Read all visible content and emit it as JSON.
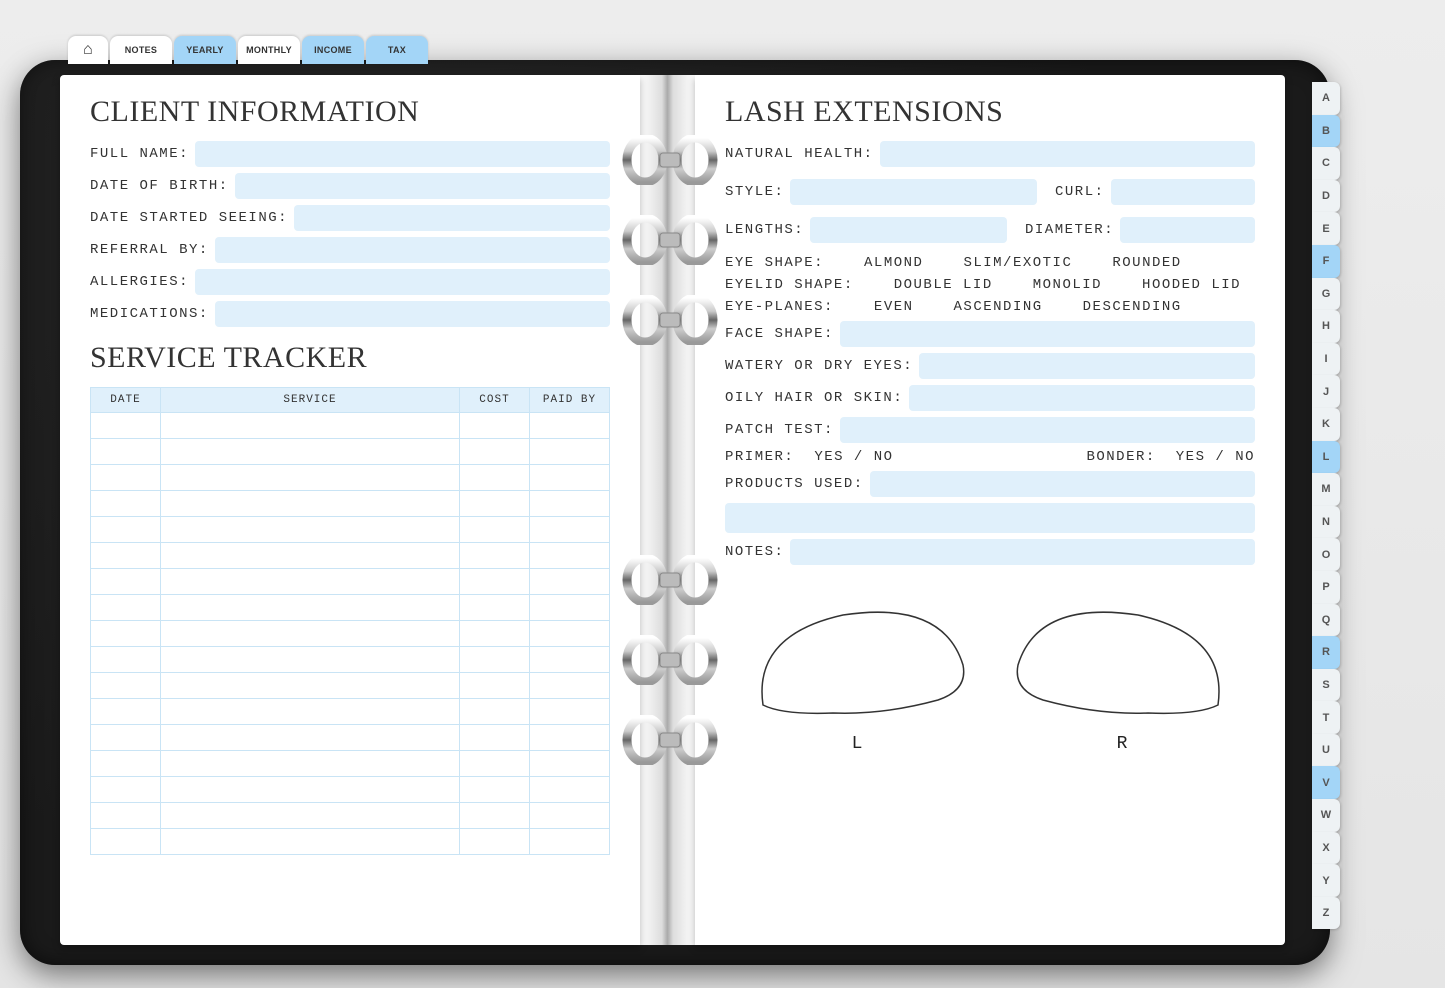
{
  "top_tabs": {
    "notes": "NOTES",
    "yearly": "YEARLY",
    "monthly": "MONTHLY",
    "income": "INCOME",
    "tax": "TAX"
  },
  "alpha_tabs": [
    "A",
    "B",
    "C",
    "D",
    "E",
    "F",
    "G",
    "H",
    "I",
    "J",
    "K",
    "L",
    "M",
    "N",
    "O",
    "P",
    "Q",
    "R",
    "S",
    "T",
    "U",
    "V",
    "W",
    "X",
    "Y",
    "Z"
  ],
  "alpha_highlights": [
    "B",
    "F",
    "L",
    "R",
    "V"
  ],
  "left": {
    "title": "CLIENT INFORMATION",
    "labels": {
      "full_name": "FULL NAME:",
      "dob": "DATE OF BIRTH:",
      "started": "DATE STARTED SEEING:",
      "referral": "REFERRAL BY:",
      "allergies": "ALLERGIES:",
      "medications": "MEDICATIONS:"
    },
    "tracker_title": "SERVICE TRACKER",
    "table_headers": {
      "date": "DATE",
      "service": "SERVICE",
      "cost": "COST",
      "paid_by": "PAID BY"
    },
    "table_rows": 17
  },
  "right": {
    "title": "LASH EXTENSIONS",
    "labels": {
      "natural_health": "NATURAL HEALTH:",
      "style": "STYLE:",
      "curl": "CURL:",
      "lengths": "LENGTHS:",
      "diameter": "DIAMETER:",
      "eye_shape": "EYE SHAPE:",
      "eyelid_shape": "EYELID SHAPE:",
      "eye_planes": "EYE-PLANES:",
      "face_shape": "FACE SHAPE:",
      "watery": "WATERY OR DRY EYES:",
      "oily": "OILY HAIR OR SKIN:",
      "patch": "PATCH TEST:",
      "primer": "PRIMER:",
      "bonder": "BONDER:",
      "products": "PRODUCTS USED:",
      "notes": "NOTES:"
    },
    "options": {
      "eye_shape": [
        "ALMOND",
        "SLIM/EXOTIC",
        "ROUNDED"
      ],
      "eyelid_shape": [
        "DOUBLE LID",
        "MONOLID",
        "HOODED LID"
      ],
      "eye_planes": [
        "EVEN",
        "ASCENDING",
        "DESCENDING"
      ],
      "yes_no": "YES / NO"
    },
    "eye_labels": {
      "left": "L",
      "right": "R"
    }
  }
}
